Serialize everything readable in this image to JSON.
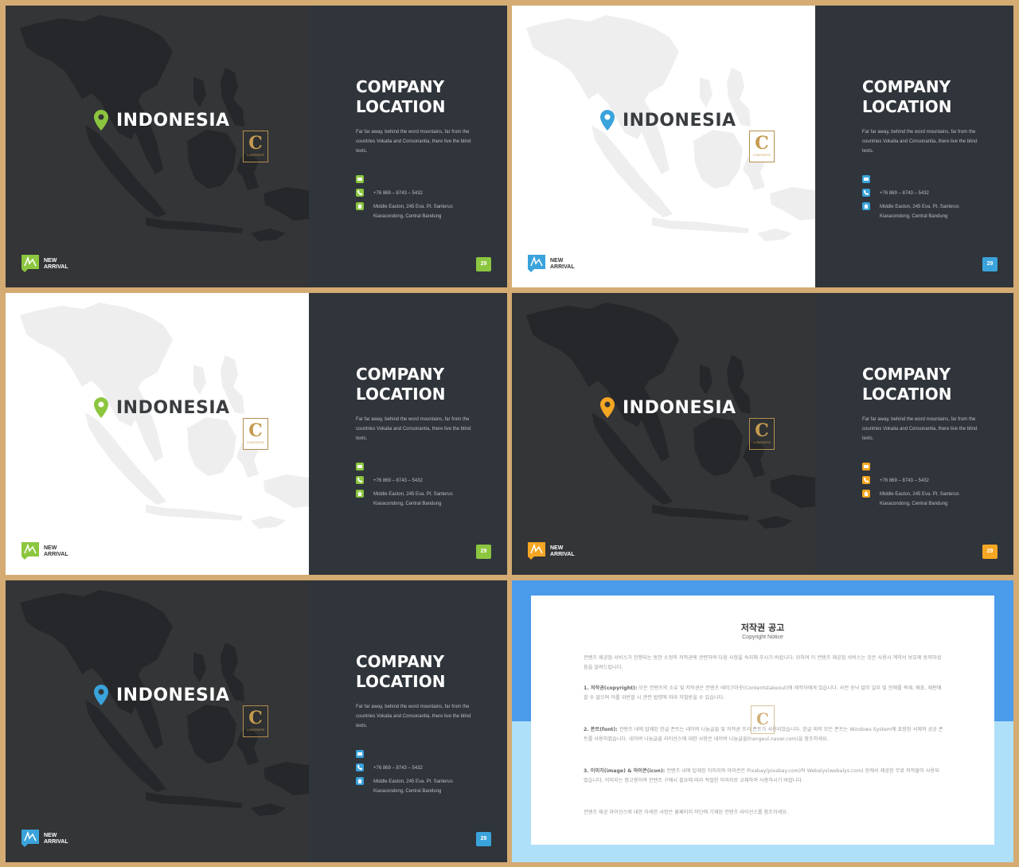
{
  "slides": [
    {
      "theme": "dark",
      "accent": "green",
      "accent_hex": "#8cc63f"
    },
    {
      "theme": "light",
      "accent": "blue",
      "accent_hex": "#3aa3db"
    },
    {
      "theme": "light",
      "accent": "green",
      "accent_hex": "#8cc63f"
    },
    {
      "theme": "dark",
      "accent": "orange",
      "accent_hex": "#f5a623"
    },
    {
      "theme": "dark",
      "accent": "blue",
      "accent_hex": "#3aa3db"
    }
  ],
  "location": {
    "country": "INDONESIA",
    "title_line1": "COMPANY",
    "title_line2": "LOCATION",
    "description": "Far far away, behind the word mountains, far from the countries Vokalia and Consonantia, there live the blind texts.",
    "phone": "+76 869 – 8743 – 5432",
    "address_line1": "Middle Easton, 245 Eva. Pt. Santerus",
    "address_line2": "Kiaracondong, Central Bandung",
    "page_number": "29",
    "logo_line1": "NEW",
    "logo_line2": "ARRIVAL",
    "badge_letter": "C",
    "badge_text": "CONTENTS"
  },
  "icons": [
    "map-pin-icon",
    "mail-icon",
    "phone-icon",
    "home-icon",
    "new-arrival-logo-icon"
  ],
  "copyright": {
    "title": "저작권 공고",
    "subtitle": "Copyright Notice",
    "intro": "컨텐츠 제공업 서비스가 진행되는 동안 소정의 저작권에 관련하여 다음 사항을 숙지해 주시기 바랍니다. 위하여 이 컨텐츠 제공업 서비스는 것은 사용시 계약서 보호에 동의하셨음을 알려드립니다.",
    "p1_label": "1. 저작권(copyright):",
    "p1_text": " 모든 컨텐츠의 소유 및 저작권은 컨텐츠 테이크아웃(Contentstakeout)에 제작자에게 있습니다. 사전 승낙 없이 일부 및 전체를 복제, 배포, 재판매할 수 없으며 이를 위반할 시 관련 법령에 따라 처벌받을 수 있습니다.",
    "p2_label": "2. 폰트(font):",
    "p2_text": " 컨텐츠 내에 탑재된 한글 폰트는 네이버 나눔글꼴 및 저작권 프리 폰트가 사용되었습니다. 한글 외의 모든 폰트는 Windows System에 포함된 서체와 공공 폰트를 사용하였습니다. 네이버 나눔글꼴 라이선스에 대한 사항은 네이버 나눔글꼴(hangeul.naver.com)을 참조하세요.",
    "p3_label": "3. 이미지(image) & 아이콘(icon):",
    "p3_text": " 컨텐츠 내에 탑재된 이미지와 아이콘은 Pixabay(pixabay.com)와 Webalys(webalys.com) 등에서 제공한 무료 저작물이 사용되었습니다. 이미지는 참고용이며 컨텐츠 구매시 필요에 따라 적절한 이미지로 교체하여 사용하시기 바랍니다.",
    "outro": "컨텐츠 제공 라이선스에 대한 자세한 사항은 홈페이지 하단에 기재된 컨텐츠 라이선스를 참조하세요.",
    "watermark": "C"
  }
}
